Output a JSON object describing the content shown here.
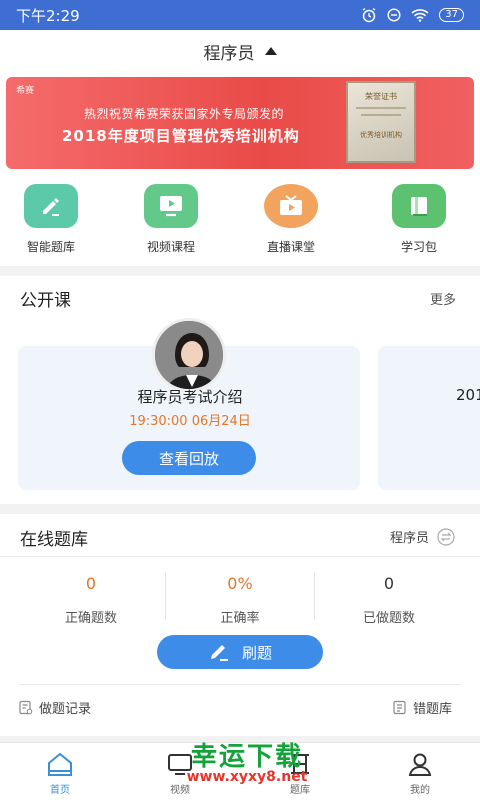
{
  "status_bar": {
    "time": "下午2:29",
    "battery": "37"
  },
  "header": {
    "title": "程序员"
  },
  "banner": {
    "logo_text": "希赛",
    "line1": "热烈祝贺希赛荣获国家外专局颁发的",
    "line2": "2018年度项目管理优秀培训机构",
    "certificate_title": "荣誉证书",
    "certificate_body": "优秀培训机构"
  },
  "quick_nav": [
    {
      "label": "智能题库",
      "icon": "edit-icon",
      "color": "#5ccaa8"
    },
    {
      "label": "视频课程",
      "icon": "monitor-play-icon",
      "color": "#62c98a"
    },
    {
      "label": "直播课堂",
      "icon": "tv-play-icon",
      "color": "#f2a35e"
    },
    {
      "label": "学习包",
      "icon": "book-icon",
      "color": "#5dc26f"
    }
  ],
  "open_course": {
    "title": "公开课",
    "more": "更多",
    "card": {
      "title": "程序员考试介绍",
      "time": "19:30:00  06月24日",
      "button": "查看回放"
    },
    "next_card_partial": "201"
  },
  "question_bank": {
    "title": "在线题库",
    "subject": "程序员",
    "stats": [
      {
        "value": "0",
        "label": "正确题数",
        "color": "#e0782b"
      },
      {
        "value": "0%",
        "label": "正确率",
        "color": "#e0782b"
      },
      {
        "value": "0",
        "label": "已做题数",
        "color": "#333333"
      }
    ],
    "practice_button": "刷题",
    "records_link": "做题记录",
    "wrong_bank_link": "错题库"
  },
  "tabbar": [
    {
      "label": "首页",
      "icon": "home-icon",
      "active": true
    },
    {
      "label": "视频",
      "icon": "video-icon",
      "active": false
    },
    {
      "label": "题库",
      "icon": "question-bank-icon",
      "active": false
    },
    {
      "label": "我的",
      "icon": "user-icon",
      "active": false
    }
  ],
  "watermark": {
    "line1": "幸运下载",
    "line2": "www.xyxy8.net"
  },
  "colors": {
    "status_bar": "#3f6ed3",
    "accent_blue": "#3d8de8",
    "banner_red": "#e94b48",
    "orange": "#e0782b"
  }
}
